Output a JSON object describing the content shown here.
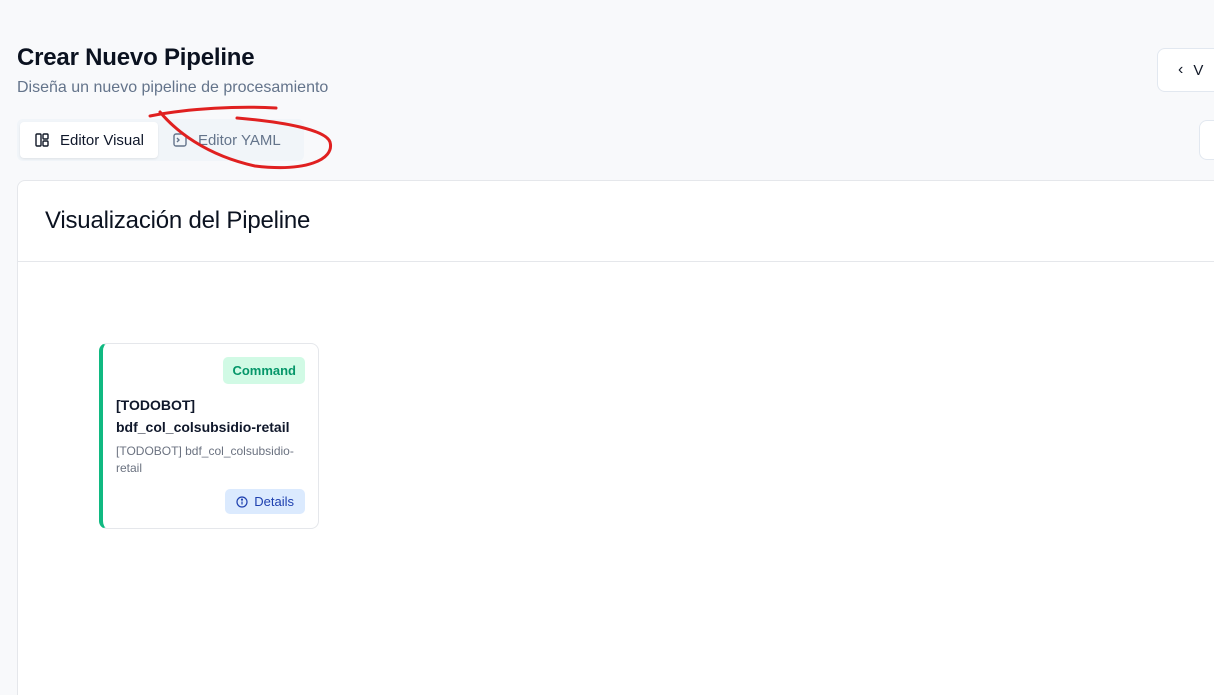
{
  "header": {
    "title": "Crear Nuevo Pipeline",
    "subtitle": "Diseña un nuevo pipeline de procesamiento",
    "back_label": "V"
  },
  "tabs": [
    {
      "label": "Editor Visual",
      "icon": "layout-icon",
      "active": true
    },
    {
      "label": "Editor YAML",
      "icon": "terminal-icon",
      "active": false
    }
  ],
  "visualization": {
    "title": "Visualización del Pipeline"
  },
  "node": {
    "badge": "Command",
    "title": "[TODOBOT] bdf_col_colsubsidio-retail",
    "description": "[TODOBOT] bdf_col_colsubsidio-retail",
    "details_label": "Details",
    "accent_color": "#10b981"
  },
  "colors": {
    "annotation": "#e02020",
    "badge_bg": "#d1fae5",
    "details_bg": "#dbeafe"
  }
}
